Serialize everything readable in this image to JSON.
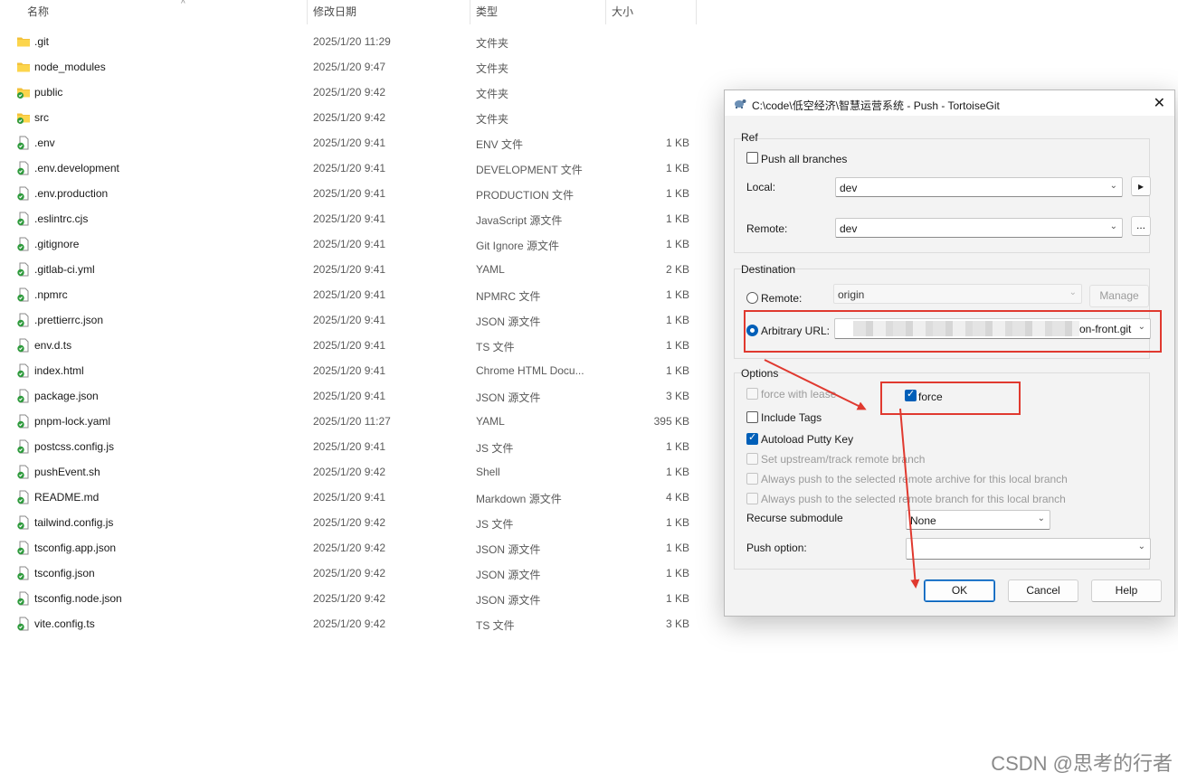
{
  "explorer": {
    "columns": {
      "name": "名称",
      "date": "修改日期",
      "type": "类型",
      "size": "大小"
    },
    "files": [
      {
        "name": ".git",
        "date": "2025/1/20 11:29",
        "type": "文件夹",
        "size": "",
        "icon": "folder-icon"
      },
      {
        "name": "node_modules",
        "date": "2025/1/20 9:47",
        "type": "文件夹",
        "size": "",
        "icon": "folder-icon"
      },
      {
        "name": "public",
        "date": "2025/1/20 9:42",
        "type": "文件夹",
        "size": "",
        "icon": "git-folder-icon"
      },
      {
        "name": "src",
        "date": "2025/1/20 9:42",
        "type": "文件夹",
        "size": "",
        "icon": "git-folder-icon"
      },
      {
        "name": ".env",
        "date": "2025/1/20 9:41",
        "type": "ENV 文件",
        "size": "1 KB",
        "icon": "git-file-icon"
      },
      {
        "name": ".env.development",
        "date": "2025/1/20 9:41",
        "type": "DEVELOPMENT 文件",
        "size": "1 KB",
        "icon": "git-file-icon"
      },
      {
        "name": ".env.production",
        "date": "2025/1/20 9:41",
        "type": "PRODUCTION 文件",
        "size": "1 KB",
        "icon": "git-file-icon"
      },
      {
        "name": ".eslintrc.cjs",
        "date": "2025/1/20 9:41",
        "type": "JavaScript 源文件",
        "size": "1 KB",
        "icon": "git-file-icon"
      },
      {
        "name": ".gitignore",
        "date": "2025/1/20 9:41",
        "type": "Git Ignore 源文件",
        "size": "1 KB",
        "icon": "git-file-icon"
      },
      {
        "name": ".gitlab-ci.yml",
        "date": "2025/1/20 9:41",
        "type": "YAML",
        "size": "2 KB",
        "icon": "git-file-icon"
      },
      {
        "name": ".npmrc",
        "date": "2025/1/20 9:41",
        "type": "NPMRC 文件",
        "size": "1 KB",
        "icon": "git-file-icon"
      },
      {
        "name": ".prettierrc.json",
        "date": "2025/1/20 9:41",
        "type": "JSON 源文件",
        "size": "1 KB",
        "icon": "git-file-icon"
      },
      {
        "name": "env.d.ts",
        "date": "2025/1/20 9:41",
        "type": "TS 文件",
        "size": "1 KB",
        "icon": "git-file-icon"
      },
      {
        "name": "index.html",
        "date": "2025/1/20 9:41",
        "type": "Chrome HTML Docu...",
        "size": "1 KB",
        "icon": "git-file-icon"
      },
      {
        "name": "package.json",
        "date": "2025/1/20 9:41",
        "type": "JSON 源文件",
        "size": "3 KB",
        "icon": "git-file-icon"
      },
      {
        "name": "pnpm-lock.yaml",
        "date": "2025/1/20 11:27",
        "type": "YAML",
        "size": "395 KB",
        "icon": "git-file-icon"
      },
      {
        "name": "postcss.config.js",
        "date": "2025/1/20 9:41",
        "type": "JS 文件",
        "size": "1 KB",
        "icon": "git-file-icon"
      },
      {
        "name": "pushEvent.sh",
        "date": "2025/1/20 9:42",
        "type": "Shell",
        "size": "1 KB",
        "icon": "git-file-icon"
      },
      {
        "name": "README.md",
        "date": "2025/1/20 9:41",
        "type": "Markdown 源文件",
        "size": "4 KB",
        "icon": "git-file-icon"
      },
      {
        "name": "tailwind.config.js",
        "date": "2025/1/20 9:42",
        "type": "JS 文件",
        "size": "1 KB",
        "icon": "git-file-icon"
      },
      {
        "name": "tsconfig.app.json",
        "date": "2025/1/20 9:42",
        "type": "JSON 源文件",
        "size": "1 KB",
        "icon": "git-file-icon"
      },
      {
        "name": "tsconfig.json",
        "date": "2025/1/20 9:42",
        "type": "JSON 源文件",
        "size": "1 KB",
        "icon": "git-file-icon"
      },
      {
        "name": "tsconfig.node.json",
        "date": "2025/1/20 9:42",
        "type": "JSON 源文件",
        "size": "1 KB",
        "icon": "git-file-icon"
      },
      {
        "name": "vite.config.ts",
        "date": "2025/1/20 9:42",
        "type": "TS 文件",
        "size": "3 KB",
        "icon": "git-file-icon"
      }
    ]
  },
  "dialog": {
    "title": "C:\\code\\低空经济\\智慧运营系统 - Push - TortoiseGit",
    "close_glyph": "✕",
    "ref": {
      "label": "Ref",
      "push_all_label": "Push all branches",
      "local_label": "Local:",
      "local_value": "dev",
      "remote_label": "Remote:",
      "remote_value": "dev",
      "next_glyph": "▸",
      "ellipsis_glyph": "..."
    },
    "destination": {
      "label": "Destination",
      "remote_radio_label": "Remote:",
      "remote_value": "origin",
      "manage_label": "Manage",
      "url_radio_label": "Arbitrary URL:",
      "url_visible_suffix": "on-front.git"
    },
    "options": {
      "label": "Options",
      "force_with_lease_label": "force with lease",
      "force_label": "force",
      "force_checked": true,
      "include_tags_label": "Include Tags",
      "include_tags_checked": false,
      "autoload_putty_label": "Autoload Putty Key",
      "autoload_putty_checked": true,
      "set_upstream_label": "Set upstream/track remote branch",
      "always_archive_label": "Always push to the selected remote archive for this local branch",
      "always_branch_label": "Always push to the selected remote branch for this local branch",
      "recurse_label": "Recurse submodule",
      "recurse_value": "None",
      "push_option_label": "Push option:",
      "push_option_value": ""
    },
    "buttons": {
      "ok": "OK",
      "cancel": "Cancel",
      "help": "Help"
    }
  },
  "chevron_glyph": "⌄",
  "sort_glyph": "^",
  "watermark": "CSDN @思考的行者",
  "colors": {
    "accent": "#005fb8",
    "annotation_red": "#e0392f"
  }
}
